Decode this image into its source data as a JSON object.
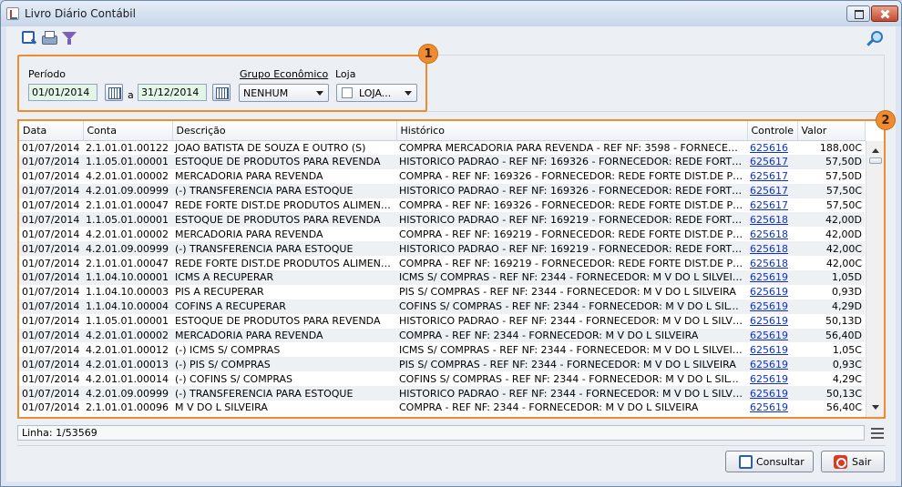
{
  "window": {
    "title": "Livro Diário Contábil"
  },
  "filters": {
    "periodo_label": "Período",
    "date_from": "01/01/2014",
    "separator": "a",
    "date_to": "31/12/2014",
    "grupo_label": "Grupo Econômico",
    "grupo_value": "NENHUM",
    "loja_label": "Loja",
    "loja_value": "LOJA..."
  },
  "badges": {
    "one": "1",
    "two": "2"
  },
  "table": {
    "headers": [
      "Data",
      "Conta",
      "Descrição",
      "Histórico",
      "Controle",
      "Valor"
    ],
    "rows": [
      [
        "01/07/2014",
        "2.1.01.01.00122",
        "JOAO BATISTA DE SOUZA E OUTRO (S)",
        "COMPRA MERCADORIA PARA REVENDA - REF NF: 3598 - FORNECEDOR: C...",
        "625616",
        "188,00C"
      ],
      [
        "01/07/2014",
        "1.1.05.01.00001",
        "ESTOQUE DE PRODUTOS PARA REVENDA",
        "HISTORICO PADRAO - REF NF: 169326 - FORNECEDOR: REDE FORTE DIST....",
        "625617",
        "57,50D"
      ],
      [
        "01/07/2014",
        "4.2.01.01.00002",
        "MERCADORIA PARA REVENDA",
        "COMPRA - REF NF: 169326 - FORNECEDOR: REDE FORTE DIST.DE PRODUT...",
        "625617",
        "57,50D"
      ],
      [
        "01/07/2014",
        "4.2.01.09.00999",
        "(-) TRANSFERENCIA PARA ESTOQUE",
        "HISTORICO PADRAO - REF NF: 169326 - FORNECEDOR: REDE FORTE DIST....",
        "625617",
        "57,50C"
      ],
      [
        "01/07/2014",
        "2.1.01.01.00047",
        "REDE FORTE DIST.DE PRODUTOS ALIMENTICIOS",
        "COMPRA - REF NF: 169326 - FORNECEDOR: REDE FORTE DIST.DE PRODUT...",
        "625617",
        "57,50C"
      ],
      [
        "01/07/2014",
        "1.1.05.01.00001",
        "ESTOQUE DE PRODUTOS PARA REVENDA",
        "HISTORICO PADRAO - REF NF: 169219 - FORNECEDOR: REDE FORTE DIST....",
        "625618",
        "42,00D"
      ],
      [
        "01/07/2014",
        "4.2.01.01.00002",
        "MERCADORIA PARA REVENDA",
        "COMPRA - REF NF: 169219 - FORNECEDOR: REDE FORTE DIST.DE PRODUT...",
        "625618",
        "42,00D"
      ],
      [
        "01/07/2014",
        "4.2.01.09.00999",
        "(-) TRANSFERENCIA PARA ESTOQUE",
        "HISTORICO PADRAO - REF NF: 169219 - FORNECEDOR: REDE FORTE DIST....",
        "625618",
        "42,00C"
      ],
      [
        "01/07/2014",
        "2.1.01.01.00047",
        "REDE FORTE DIST.DE PRODUTOS ALIMENTICIOS",
        "COMPRA - REF NF: 169219 - FORNECEDOR: REDE FORTE DIST.DE PRODUT...",
        "625618",
        "42,00C"
      ],
      [
        "01/07/2014",
        "1.1.04.10.00001",
        "ICMS A RECUPERAR",
        "ICMS S/ COMPRAS - REF NF: 2344 - FORNECEDOR: M V DO L SILVEIRA",
        "625619",
        "1,05D"
      ],
      [
        "01/07/2014",
        "1.1.04.10.00003",
        "PIS A RECUPERAR",
        "PIS S/ COMPRAS - REF NF: 2344 - FORNECEDOR: M V DO L SILVEIRA",
        "625619",
        "0,93D"
      ],
      [
        "01/07/2014",
        "1.1.04.10.00004",
        "COFINS A RECUPERAR",
        "COFINS S/  COMPRAS - REF NF: 2344 - FORNECEDOR: M V DO L SILVEIRA",
        "625619",
        "4,29D"
      ],
      [
        "01/07/2014",
        "1.1.05.01.00001",
        "ESTOQUE DE PRODUTOS PARA REVENDA",
        "HISTORICO PADRAO - REF NF: 2344 - FORNECEDOR: M V DO L SILVEIRA",
        "625619",
        "50,13D"
      ],
      [
        "01/07/2014",
        "4.2.01.01.00002",
        "MERCADORIA PARA REVENDA",
        "COMPRA - REF NF: 2344 - FORNECEDOR: M V DO L SILVEIRA",
        "625619",
        "56,40D"
      ],
      [
        "01/07/2014",
        "4.2.01.01.00012",
        "(-) ICMS S/ COMPRAS",
        "ICMS S/ COMPRAS - REF NF: 2344 - FORNECEDOR: M V DO L SILVEIRA",
        "625619",
        "1,05C"
      ],
      [
        "01/07/2014",
        "4.2.01.01.00013",
        "(-) PIS S/ COMPRAS",
        "PIS S/ COMPRAS - REF NF: 2344 - FORNECEDOR: M V DO L SILVEIRA",
        "625619",
        "0,93C"
      ],
      [
        "01/07/2014",
        "4.2.01.01.00014",
        "(-) COFINS S/ COMPRAS",
        "COFINS S/  COMPRAS - REF NF: 2344 - FORNECEDOR: M V DO L SILVEIRA",
        "625619",
        "4,29C"
      ],
      [
        "01/07/2014",
        "4.2.01.09.00999",
        "(-) TRANSFERENCIA PARA ESTOQUE",
        "HISTORICO PADRAO - REF NF: 2344 - FORNECEDOR: M V DO L SILVEIRA",
        "625619",
        "50,13C"
      ],
      [
        "01/07/2014",
        "2.1.01.01.00096",
        "M V DO L SILVEIRA",
        "COMPRA - REF NF: 2344 - FORNECEDOR: M V DO L SILVEIRA",
        "625619",
        "56,40C"
      ]
    ]
  },
  "status": {
    "line_text": "Linha: 1/53569"
  },
  "actions": {
    "consultar_label": "Consultar",
    "sair_label": "Sair"
  },
  "icons": {
    "toolbar": [
      "search-icon",
      "print-icon",
      "filter-icon"
    ],
    "right": "key-icon"
  },
  "colors": {
    "highlight": "#ef8c32",
    "link": "#0b33cc",
    "date_field": "#e3f5e6"
  }
}
